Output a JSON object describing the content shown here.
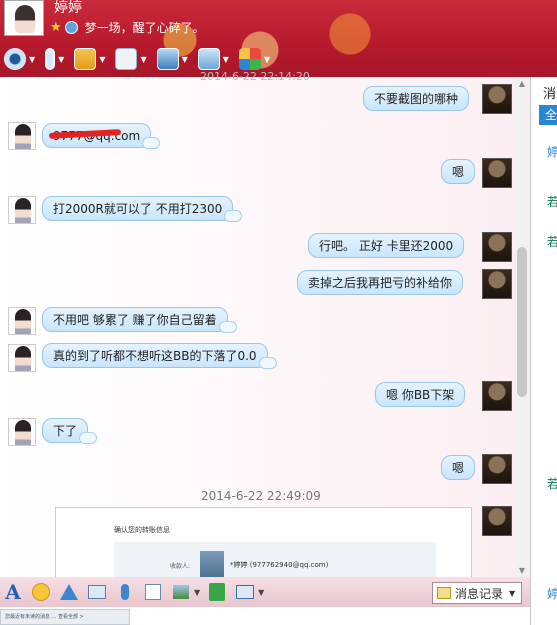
{
  "header": {
    "nickname": "婷婷",
    "signature": "梦一场，醒了心碎了。"
  },
  "toolbar_icons": [
    "video-call-icon",
    "voice-call-icon",
    "file-transfer-icon",
    "create-group-icon",
    "remote-assist-icon",
    "share-screen-icon",
    "apps-icon"
  ],
  "chat": {
    "overlay_timestamp": "2014-6-22 22:14:20",
    "messages": [
      {
        "side": "right",
        "text": "不要截图的哪种"
      },
      {
        "side": "left",
        "text": "9777@qq.com"
      },
      {
        "side": "right",
        "text": "嗯"
      },
      {
        "side": "left",
        "text": "打2000R就可以了  不用打2300"
      },
      {
        "side": "right",
        "text": "行吧。 正好 卡里还2000"
      },
      {
        "side": "right",
        "text": "卖掉之后我再把亏的补给你"
      },
      {
        "side": "left",
        "text": "不用吧    够累了  赚了你自己留着"
      },
      {
        "side": "left",
        "text": "真的到了听都不想听这BB的下落了0.0"
      },
      {
        "side": "right",
        "text": "嗯  你BB下架"
      },
      {
        "side": "left",
        "text": "下了"
      },
      {
        "side": "right",
        "text": "嗯"
      }
    ],
    "timestamp": "2014-6-22 22:49:09",
    "screenshot": {
      "title": "确认您的转账信息",
      "label": "收款人:",
      "receiver": "*婷婷 (977762940@qq.com)"
    }
  },
  "bottom_toolbar": {
    "font_label": "A",
    "history_label": "消息记录"
  },
  "input_preview": "您最近有未读的消息 ... 查看全部 >",
  "sidebar": {
    "title": "消",
    "tab": "全",
    "items": [
      "婷",
      "若",
      "若",
      "若",
      "婷"
    ]
  }
}
